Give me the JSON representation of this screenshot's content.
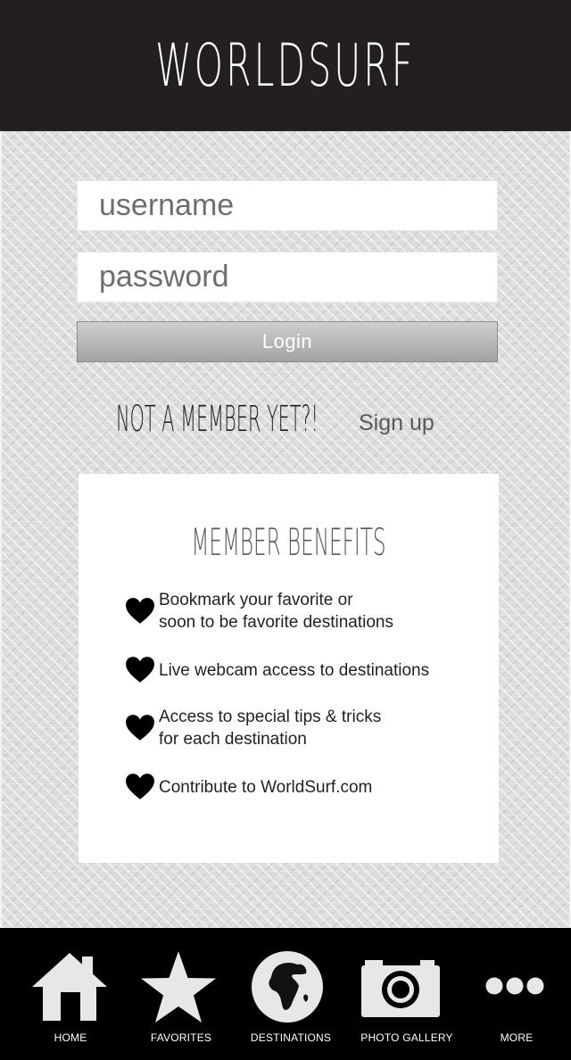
{
  "header": {
    "logo": "WORLDSURF"
  },
  "login": {
    "username_placeholder": "username",
    "password_placeholder": "password",
    "login_label": "Login"
  },
  "signup": {
    "prompt": "NOT A MEMBER YET?!",
    "link": "Sign up"
  },
  "benefits": {
    "title": "MEMBER BENEFITS",
    "icon": "heart-icon",
    "items": [
      {
        "text": "Bookmark your favorite or\nsoon to be favorite destinations"
      },
      {
        "text": "Live webcam access to destinations"
      },
      {
        "text": "Access to special tips & tricks\nfor each destination"
      },
      {
        "text": "Contribute to WorldSurf.com"
      }
    ]
  },
  "nav": {
    "items": [
      {
        "label": "HOME",
        "icon": "home-icon"
      },
      {
        "label": "FAVORITES",
        "icon": "star-icon"
      },
      {
        "label": "DESTINATIONS",
        "icon": "globe-icon"
      },
      {
        "label": "PHOTO GALLERY",
        "icon": "camera-icon"
      },
      {
        "label": "MORE",
        "icon": "more-icon"
      }
    ]
  },
  "colors": {
    "header_bg": "#231f20",
    "nav_bg": "#000000",
    "icon_fill": "#e6e7e8"
  }
}
